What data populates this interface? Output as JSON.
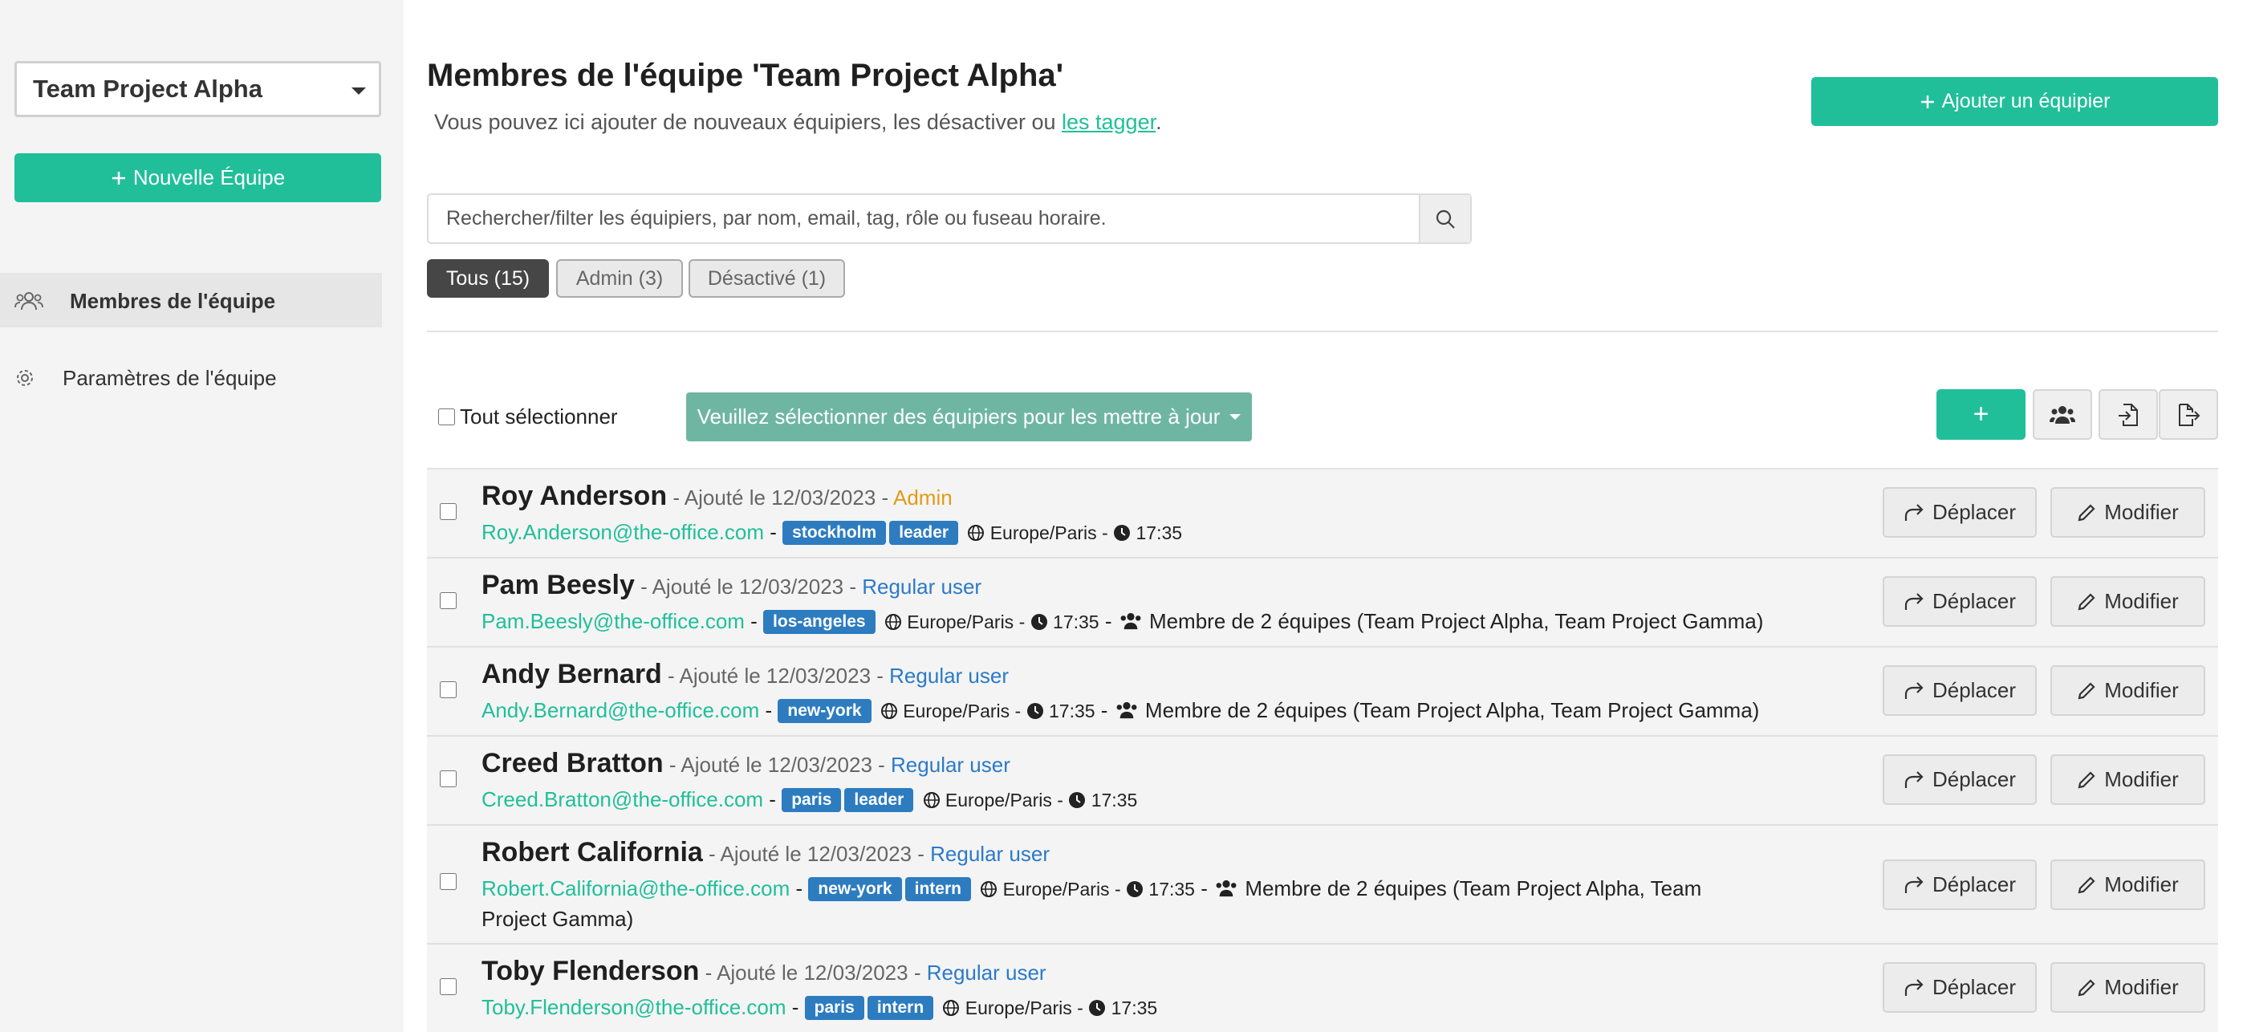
{
  "sidebar": {
    "team_select": "Team Project Alpha",
    "new_team_label": "Nouvelle Équipe",
    "nav": [
      {
        "label": "Membres de l'équipe",
        "icon": "users-icon",
        "active": true
      },
      {
        "label": "Paramètres de l'équipe",
        "icon": "gear-icon",
        "active": false
      }
    ]
  },
  "header": {
    "title": "Membres de l'équipe 'Team Project Alpha'",
    "subtitle_prefix": "Vous pouvez ici ajouter de nouveaux équipiers, les désactiver ou ",
    "subtitle_link": "les tagger",
    "subtitle_suffix": ".",
    "add_member_label": "Ajouter un équipier"
  },
  "search": {
    "placeholder": "Rechercher/filter les équipiers, par nom, email, tag, rôle ou fuseau horaire."
  },
  "filters": [
    {
      "label": "Tous (15)",
      "active": true
    },
    {
      "label": "Admin (3)",
      "active": false
    },
    {
      "label": "Désactivé (1)",
      "active": false
    }
  ],
  "toolbar": {
    "select_all_label": "Tout sélectionner",
    "bulk_label": "Veuillez sélectionner des équipiers pour les mettre à jour",
    "add_symbol": "+"
  },
  "row_actions": {
    "move": "Déplacer",
    "edit": "Modifier"
  },
  "members": [
    {
      "name": "Roy Anderson",
      "added": "Ajouté le 12/03/2023",
      "role": "Admin",
      "email": "Roy.Anderson@the-office.com",
      "tags": [
        "stockholm",
        "leader"
      ],
      "timezone": "Europe/Paris",
      "time": "17:35",
      "teams": ""
    },
    {
      "name": "Pam Beesly",
      "added": "Ajouté le 12/03/2023",
      "role": "Regular user",
      "email": "Pam.Beesly@the-office.com",
      "tags": [
        "los-angeles"
      ],
      "timezone": "Europe/Paris",
      "time": "17:35",
      "teams": "Membre de 2 équipes (Team Project Alpha, Team Project Gamma)"
    },
    {
      "name": "Andy Bernard",
      "added": "Ajouté le 12/03/2023",
      "role": "Regular user",
      "email": "Andy.Bernard@the-office.com",
      "tags": [
        "new-york"
      ],
      "timezone": "Europe/Paris",
      "time": "17:35",
      "teams": "Membre de 2 équipes (Team Project Alpha, Team Project Gamma)"
    },
    {
      "name": "Creed Bratton",
      "added": "Ajouté le 12/03/2023",
      "role": "Regular user",
      "email": "Creed.Bratton@the-office.com",
      "tags": [
        "paris",
        "leader"
      ],
      "timezone": "Europe/Paris",
      "time": "17:35",
      "teams": ""
    },
    {
      "name": "Robert California",
      "added": "Ajouté le 12/03/2023",
      "role": "Regular user",
      "email": "Robert.California@the-office.com",
      "tags": [
        "new-york",
        "intern"
      ],
      "timezone": "Europe/Paris",
      "time": "17:35",
      "teams": "Membre de 2 équipes (Team Project Alpha, Team Project Gamma)"
    },
    {
      "name": "Toby Flenderson",
      "added": "Ajouté le 12/03/2023",
      "role": "Regular user",
      "email": "Toby.Flenderson@the-office.com",
      "tags": [
        "paris",
        "intern"
      ],
      "timezone": "Europe/Paris",
      "time": "17:35",
      "teams": ""
    }
  ]
}
